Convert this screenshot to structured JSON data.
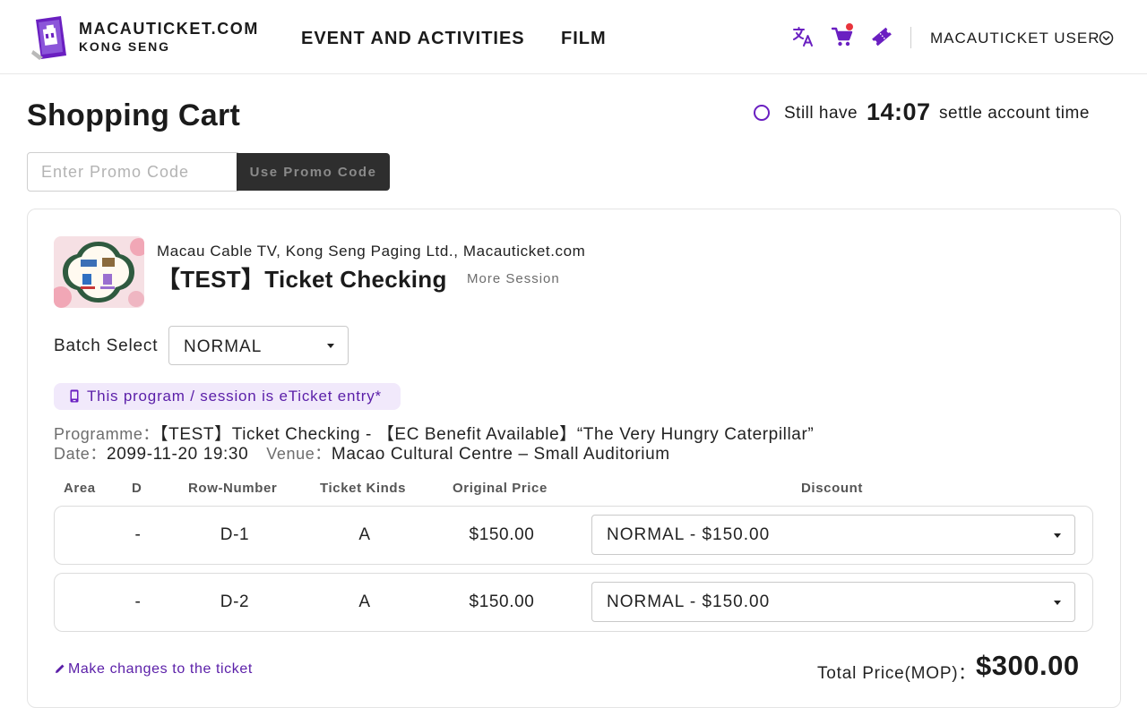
{
  "header": {
    "brand_line1": "MACAUTICKET.COM",
    "brand_line2": "KONG SENG",
    "nav": [
      "EVENT AND ACTIVITIES",
      "FILM"
    ],
    "icons": [
      "translate-icon",
      "cart-icon",
      "ticket-icon"
    ],
    "user_label": "MACAUTICKET USER",
    "accent_color": "#6a1fc1",
    "cart_badge_color": "#e8343c"
  },
  "page": {
    "title": "Shopping Cart",
    "timer_prefix": "Still have",
    "timer_value": "14:07",
    "timer_suffix": "settle account time"
  },
  "promo": {
    "placeholder": "Enter Promo Code",
    "button_label": "Use Promo Code"
  },
  "event": {
    "organizer": "Macau Cable TV, Kong Seng Paging Ltd., Macauticket.com",
    "title": "【TEST】Ticket Checking",
    "more_session": "More Session",
    "batch_label": "Batch Select",
    "batch_value": "NORMAL",
    "eticket_notice": "This program / session is eTicket entry*",
    "programme_label": "Programme：",
    "programme_value": "【TEST】Ticket Checking - 【EC Benefit Available】“The Very Hungry Caterpillar”",
    "date_label": "Date：",
    "date_value": "2099-11-20 19:30",
    "venue_label": "Venue：",
    "venue_value": "Macao Cultural Centre – Small Auditorium"
  },
  "table": {
    "headers": [
      "Area",
      "D",
      "Row-Number",
      "Ticket Kinds",
      "Original Price",
      "Discount"
    ],
    "rows": [
      {
        "area": "",
        "d": "-",
        "row_number": "D-1",
        "kind": "A",
        "original_price": "$150.00",
        "discount": "NORMAL - $150.00"
      },
      {
        "area": "",
        "d": "-",
        "row_number": "D-2",
        "kind": "A",
        "original_price": "$150.00",
        "discount": "NORMAL - $150.00"
      }
    ]
  },
  "footer": {
    "make_changes": "Make changes to the ticket",
    "total_label": "Total Price(MOP)：",
    "total_value": "$300.00"
  }
}
